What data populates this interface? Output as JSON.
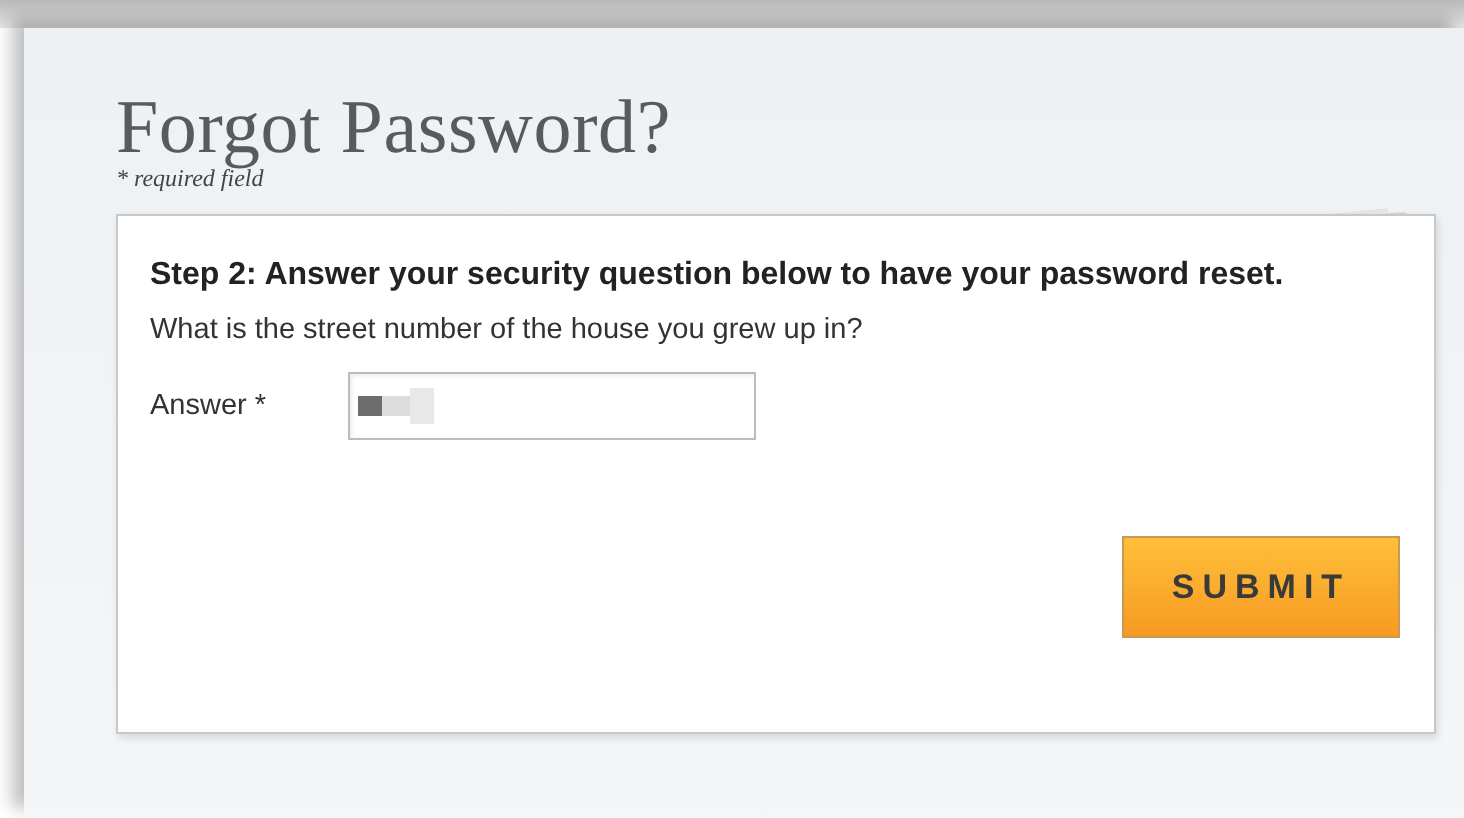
{
  "title": "Forgot Password?",
  "required_note": "* required field",
  "form": {
    "step": "Step 2: Answer your security question below to have your password reset.",
    "question": "What is the street number of the house you grew up in?",
    "answer_label": "Answer *",
    "submit": "SUBMIT"
  }
}
